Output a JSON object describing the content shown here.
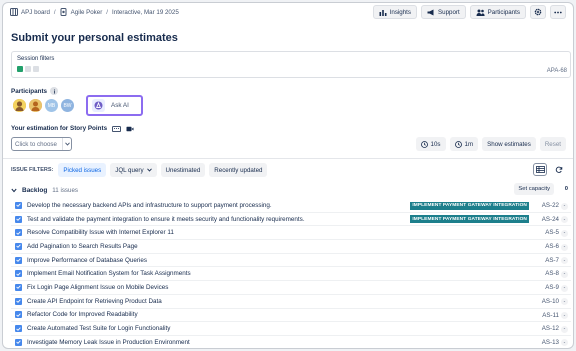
{
  "breadcrumbs": {
    "board": "APJ board",
    "sep1": "/",
    "project": "Agile Poker",
    "sep2": "/",
    "session": "Interactive, Mar 19 2025"
  },
  "toolbar": {
    "insights": "Insights",
    "support": "Support",
    "participants": "Participants",
    "settings_icon": "gear-icon",
    "more_icon": "more-icon"
  },
  "page_title": "Submit your personal estimates",
  "session_filters": {
    "label": "Session filters",
    "issue_key": "APA-68",
    "chip_colors": [
      "#22a06b",
      "#dcdfe4",
      "#dcdfe4"
    ]
  },
  "participants": {
    "label": "Participants",
    "count_icon": "info-icon",
    "avatars": [
      {
        "initials": "",
        "color": "#c98b3a"
      },
      {
        "initials": "",
        "color": "#e07a5f"
      },
      {
        "initials": "MB",
        "color": "#a0c4e8"
      },
      {
        "initials": "BW",
        "color": "#8fb4e0"
      }
    ],
    "ask_ai": "Ask AI"
  },
  "estimation": {
    "label": "Your estimation for Story Points",
    "choose_placeholder": "Click to choose",
    "timer_10s": "10s",
    "timer_1m": "1m",
    "show_estimates": "Show estimates",
    "reset": "Reset"
  },
  "issue_filters": {
    "label": "ISSUE FILTERS:",
    "tabs": [
      "Picked issues",
      "JQL query",
      "Unestimated",
      "Recently updated"
    ]
  },
  "backlog": {
    "title": "Backlog",
    "count": "11 issues",
    "set_capacity": "Set capacity",
    "capacity_value": "0"
  },
  "issues": [
    {
      "title": "Develop the necessary backend APIs and infrastructure to support payment processing.",
      "epic": "IMPLEMENT PAYMENT GATEWAY INTEGRATION",
      "key": "AS-22"
    },
    {
      "title": "Test and validate the payment integration to ensure it meets security and functionality requirements.",
      "epic": "IMPLEMENT PAYMENT GATEWAY INTEGRATION",
      "key": "AS-24"
    },
    {
      "title": "Resolve Compatibility Issue with Internet Explorer 11",
      "epic": "",
      "key": "AS-5"
    },
    {
      "title": "Add Pagination to Search Results Page",
      "epic": "",
      "key": "AS-6"
    },
    {
      "title": "Improve Performance of Database Queries",
      "epic": "",
      "key": "AS-7"
    },
    {
      "title": "Implement Email Notification System for Task Assignments",
      "epic": "",
      "key": "AS-8"
    },
    {
      "title": "Fix Login Page Alignment Issue on Mobile Devices",
      "epic": "",
      "key": "AS-9"
    },
    {
      "title": "Create API Endpoint for Retrieving Product Data",
      "epic": "",
      "key": "AS-10"
    },
    {
      "title": "Refactor Code for Improved Readability",
      "epic": "",
      "key": "AS-11"
    },
    {
      "title": "Create Automated Test Suite for Login Functionality",
      "epic": "",
      "key": "AS-12"
    },
    {
      "title": "Investigate Memory Leak Issue in Production Environment",
      "epic": "",
      "key": "AS-13"
    }
  ],
  "estimate_placeholder": "-"
}
